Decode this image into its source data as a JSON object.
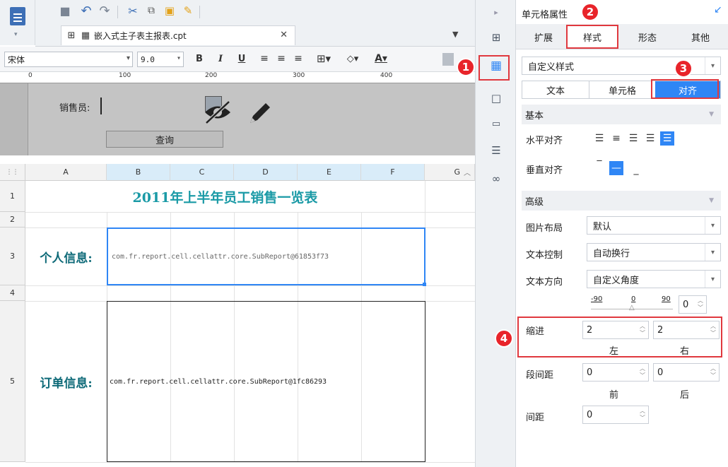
{
  "window": {
    "tab_file": "嵌入式主子表主报表.cpt"
  },
  "format_bar": {
    "font_name": "宋体",
    "font_size": "9.0",
    "bold": "B",
    "italic": "I",
    "underline": "U"
  },
  "ruler": {
    "ticks": [
      "0",
      "100",
      "200",
      "300",
      "400"
    ]
  },
  "param_area": {
    "salesperson_label": "销售员:",
    "query_button": "查询"
  },
  "grid": {
    "columns": [
      "A",
      "B",
      "C",
      "D",
      "E",
      "F",
      "G"
    ],
    "rows": [
      "1",
      "2",
      "3",
      "4",
      "5"
    ],
    "title": "2011年上半年员工销售一览表",
    "row3_label": "个人信息:",
    "row3_sub": "com.fr.report.cell.cellattr.core.SubReport@61853f73",
    "row5_label": "订单信息:",
    "row5_sub": "com.fr.report.cell.cellattr.core.SubReport@1fc86293"
  },
  "panel": {
    "title": "单元格属性",
    "tabs": [
      "扩展",
      "样式",
      "形态",
      "其他"
    ],
    "style_mode": "自定义样式",
    "subtabs": [
      "文本",
      "单元格",
      "对齐"
    ],
    "section_basic": "基本",
    "h_align_label": "水平对齐",
    "v_align_label": "垂直对齐",
    "section_adv": "高级",
    "image_layout_label": "图片布局",
    "image_layout_value": "默认",
    "text_control_label": "文本控制",
    "text_control_value": "自动换行",
    "text_dir_label": "文本方向",
    "text_dir_value": "自定义角度",
    "angle_min": "-90",
    "angle_zero": "0",
    "angle_max": "90",
    "angle_value": "0",
    "indent_label": "缩进",
    "indent_left": "2",
    "indent_right": "2",
    "left_caption": "左",
    "right_caption": "右",
    "para_label": "段间距",
    "para_before": "0",
    "para_after": "0",
    "before_caption": "前",
    "after_caption": "后",
    "spacing_label": "间距",
    "spacing_value": "0"
  },
  "badges": [
    "1",
    "2",
    "3",
    "4"
  ],
  "colors": {
    "accent": "#2f86f5",
    "badge": "#e8242a",
    "title_text": "#1a9aa6",
    "label_text": "#0e6a78"
  }
}
